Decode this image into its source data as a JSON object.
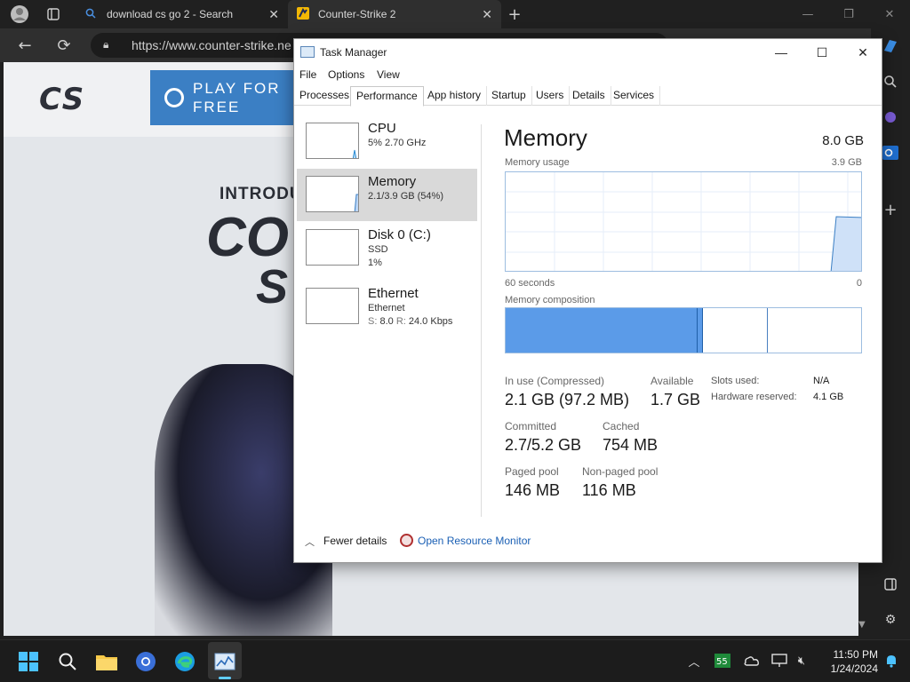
{
  "browser": {
    "tabs": [
      {
        "title": "download cs go 2 - Search"
      },
      {
        "title": "Counter-Strike 2"
      }
    ],
    "url": "https://www.counter-strike.ne"
  },
  "webpage": {
    "logo_text": "CS",
    "play_button": {
      "label": "PLAY FOR FREE"
    },
    "intro_text": "INTRODUC",
    "big_line1": "CO",
    "big_line2": "S"
  },
  "task_manager": {
    "title": "Task Manager",
    "menu": [
      "File",
      "Options",
      "View"
    ],
    "tabs": [
      "Processes",
      "Performance",
      "App history",
      "Startup",
      "Users",
      "Details",
      "Services"
    ],
    "active_tab": "Performance",
    "resources": [
      {
        "name": "CPU",
        "sub": "5%  2.70 GHz",
        "sub2": "",
        "usage_percent": 5
      },
      {
        "name": "Memory",
        "sub": "2.1/3.9 GB (54%)",
        "sub2": "",
        "usage_percent": 54
      },
      {
        "name": "Disk 0 (C:)",
        "sub": "SSD",
        "sub2": "1%",
        "usage_percent": 1
      },
      {
        "name": "Ethernet",
        "sub": "Ethernet",
        "sub2_s_label": "S:",
        "sub2_s_val": "8.0",
        "sub2_r_label": "R:",
        "sub2_r_val": "24.0 Kbps"
      }
    ],
    "selected_resource": "Memory",
    "detail": {
      "title": "Memory",
      "total": "8.0 GB",
      "usage_label": "Memory usage",
      "usage_max": "3.9 GB",
      "axis_left": "60 seconds",
      "axis_right": "0",
      "composition_label": "Memory composition",
      "composition": {
        "in_use_fraction": 0.54,
        "modified_fraction": 0.015,
        "standby_fraction": 0.18
      },
      "stats": [
        {
          "label": "In use (Compressed)",
          "value": "2.1 GB (97.2 MB)"
        },
        {
          "label": "Available",
          "value": "1.7 GB"
        },
        {
          "label": "Committed",
          "value": "2.7/5.2 GB"
        },
        {
          "label": "Cached",
          "value": "754 MB"
        },
        {
          "label": "Paged pool",
          "value": "146 MB"
        },
        {
          "label": "Non-paged pool",
          "value": "116 MB"
        }
      ],
      "kv": [
        {
          "label": "Slots used:",
          "value": "N/A"
        },
        {
          "label": "Hardware reserved:",
          "value": "4.1 GB"
        }
      ]
    },
    "footer": {
      "fewer_details": "Fewer details",
      "resource_monitor": "Open Resource Monitor"
    }
  },
  "taskbar": {
    "clock_time": "11:50 PM",
    "clock_date": "1/24/2024",
    "tray_badge": "55"
  },
  "colors": {
    "accent": "#3b7fc4",
    "graph_fill": "#5b9be8",
    "graph_line": "#9dbde0",
    "link": "#1a5fb4"
  }
}
